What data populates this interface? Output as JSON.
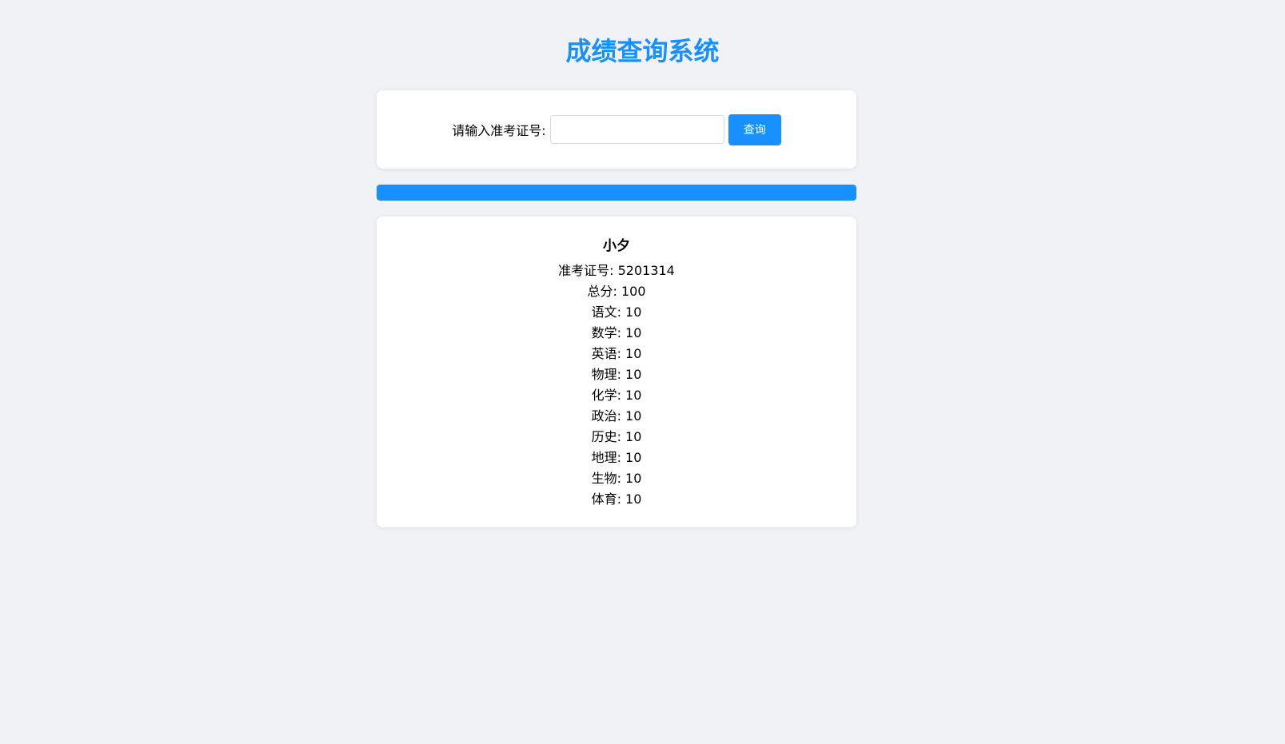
{
  "header": {
    "title": "成绩查询系统"
  },
  "search": {
    "label": "请输入准考证号:",
    "value": "",
    "placeholder": "",
    "button_label": "查询"
  },
  "progress": {
    "percent": 100,
    "color": "#1890ff"
  },
  "result": {
    "name": "小夕",
    "lines": [
      "准考证号: 5201314",
      "总分: 100",
      "语文: 10",
      "数学: 10",
      "英语: 10",
      "物理: 10",
      "化学: 10",
      "政治: 10",
      "历史: 10",
      "地理: 10",
      "生物: 10",
      "体育: 10"
    ]
  },
  "colors": {
    "accent": "#1890ff",
    "background": "#f0f2f5",
    "card": "#ffffff"
  }
}
